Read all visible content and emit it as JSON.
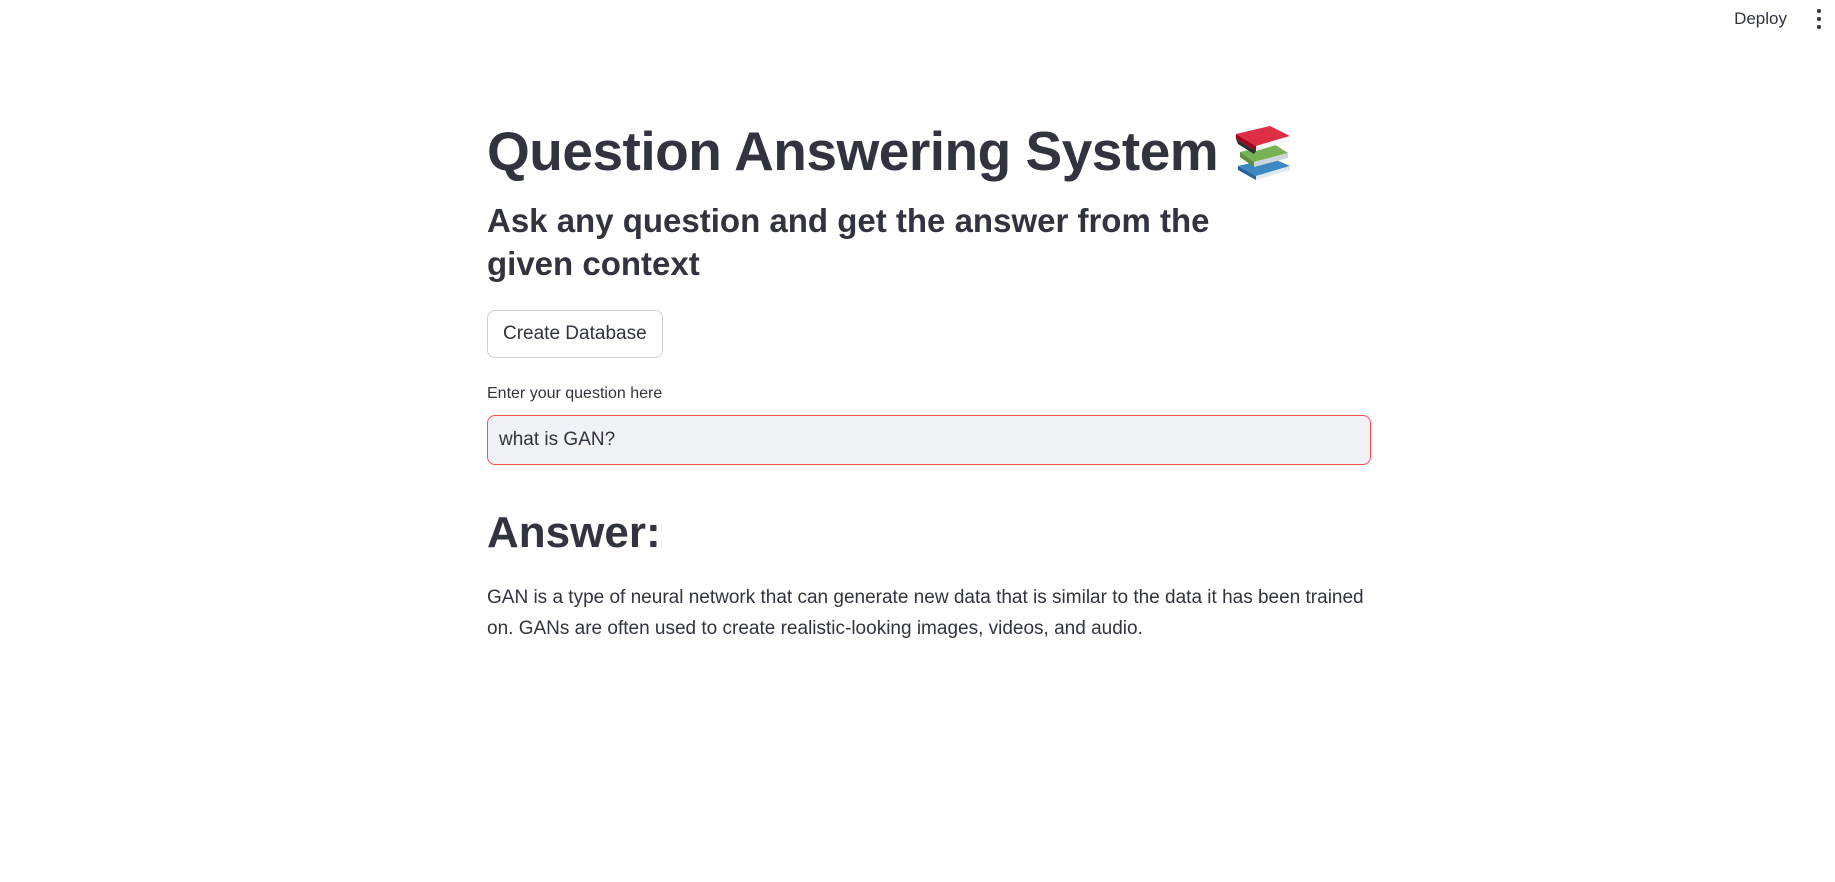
{
  "header": {
    "deploy_label": "Deploy"
  },
  "main": {
    "title": "Question Answering System",
    "subtitle": "Ask any question and get the answer from the given context",
    "create_db_label": "Create Database",
    "question_label": "Enter your question here",
    "question_value": "what is GAN?",
    "answer_heading": "Answer:",
    "answer_text": "GAN is a type of neural network that can generate new data that is similar to the data it has been trained on. GANs are often used to create realistic-looking images, videos, and audio."
  },
  "icons": {
    "title_icon": "books-icon",
    "menu_icon": "kebab-menu-icon"
  },
  "colors": {
    "text": "#31333f",
    "accent": "#ff4b4b",
    "input_bg": "#f0f2f6"
  }
}
